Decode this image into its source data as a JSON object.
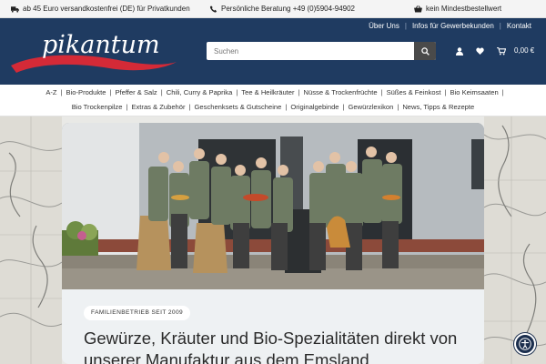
{
  "topbar": {
    "shipping": "ab 45 Euro versandkostenfrei (DE) für Privatkunden",
    "phone": "Persönliche Beratung +49 (0)5904-94902",
    "minorder": "kein Mindestbestellwert"
  },
  "header": {
    "links": [
      "Über Uns",
      "Infos für Gewerbekunden",
      "Kontakt"
    ],
    "logo_text": "pikantum",
    "search_placeholder": "Suchen",
    "cart_total": "0,00 €"
  },
  "nav": {
    "row1": [
      "A-Z",
      "Bio-Produkte",
      "Pfeffer & Salz",
      "Chili, Curry & Paprika",
      "Tee & Heilkräuter",
      "Nüsse & Trockenfrüchte",
      "Süßes & Feinkost",
      "Bio Keimsaaten"
    ],
    "row2": [
      "Bio Trockenpilze",
      "Extras & Zubehör",
      "Geschenksets & Gutscheine",
      "Originalgebinde",
      "Gewürzlexikon",
      "News, Tipps & Rezepte"
    ]
  },
  "hero": {
    "badge": "FAMILIENBETRIEB SEIT 2009",
    "headline": "Gewürze, Kräuter und Bio-Spezialitäten direkt von unserer Manufaktur aus dem Emsland"
  },
  "colors": {
    "header_bg": "#1f3b61",
    "logo_swoosh": "#d42a37",
    "search_button": "#4a4a4a",
    "a11y_button": "#1c2f4e"
  },
  "icons": [
    "truck-icon",
    "phone-icon",
    "basket-icon",
    "search-icon",
    "user-icon",
    "heart-icon",
    "cart-icon",
    "accessibility-icon"
  ]
}
